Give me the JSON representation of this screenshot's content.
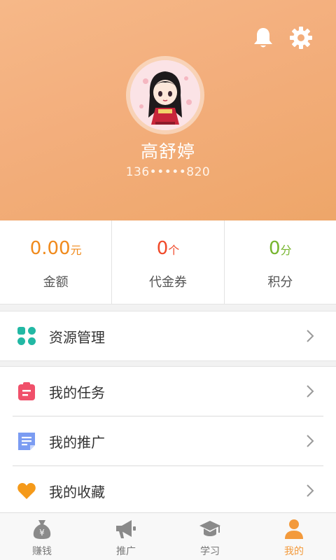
{
  "profile": {
    "name": "高舒婷",
    "phone": "136•••••820"
  },
  "stats": [
    {
      "value": "0.00",
      "unit": "元",
      "label": "金额",
      "color": "#f08a1c"
    },
    {
      "value": "0",
      "unit": "个",
      "label": "代金券",
      "color": "#f04a2a"
    },
    {
      "value": "0",
      "unit": "分",
      "label": "积分",
      "color": "#76b52e"
    }
  ],
  "menu": {
    "resource": {
      "label": "资源管理",
      "icon": "grid-icon",
      "color": "#22b8a4"
    },
    "tasks": {
      "label": "我的任务",
      "icon": "clipboard-icon",
      "color": "#f0506a"
    },
    "promotion": {
      "label": "我的推广",
      "icon": "document-icon",
      "color": "#7b9cf2"
    },
    "favorites": {
      "label": "我的收藏",
      "icon": "heart-icon",
      "color": "#f59a1a"
    }
  },
  "tabs": [
    {
      "label": "赚钱",
      "icon": "money-bag-icon",
      "active": false
    },
    {
      "label": "推广",
      "icon": "megaphone-icon",
      "active": false
    },
    {
      "label": "学习",
      "icon": "graduation-cap-icon",
      "active": false
    },
    {
      "label": "我的",
      "icon": "person-icon",
      "active": true
    }
  ],
  "colors": {
    "header_gradient_start": "#f6b888",
    "header_gradient_end": "#eea669",
    "active_tab": "#f39a3c",
    "inactive_tab": "#777777"
  }
}
